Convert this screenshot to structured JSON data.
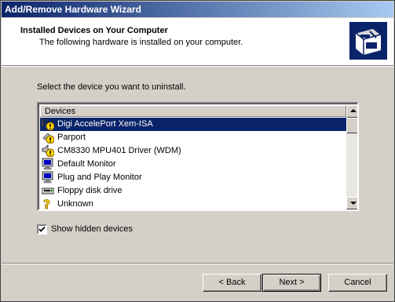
{
  "window": {
    "title": "Add/Remove Hardware Wizard"
  },
  "header": {
    "title": "Installed Devices on Your Computer",
    "subtitle": "The following hardware is installed on your computer."
  },
  "instruction": "Select the device you want to uninstall.",
  "device_list": {
    "column_header": "Devices",
    "items": [
      {
        "label": "Digi AccelePort Xem-ISA",
        "icon": "warning-network-icon",
        "selected": true
      },
      {
        "label": "Parport",
        "icon": "warning-icon",
        "selected": false
      },
      {
        "label": "CM8330 MPU401 Driver (WDM)",
        "icon": "warning-sound-icon",
        "selected": false
      },
      {
        "label": "Default Monitor",
        "icon": "monitor-icon",
        "selected": false
      },
      {
        "label": "Plug and Play Monitor",
        "icon": "monitor-icon",
        "selected": false
      },
      {
        "label": "Floppy disk drive",
        "icon": "floppy-drive-icon",
        "selected": false
      },
      {
        "label": "Unknown",
        "icon": "unknown-device-icon",
        "selected": false
      }
    ]
  },
  "show_hidden": {
    "label": "Show hidden devices",
    "checked": true
  },
  "buttons": {
    "back": "< Back",
    "next": "Next >",
    "cancel": "Cancel"
  },
  "colors": {
    "title_start": "#0a246a",
    "title_end": "#a6caf0",
    "selection": "#0a246a",
    "face": "#d4d0c8"
  }
}
